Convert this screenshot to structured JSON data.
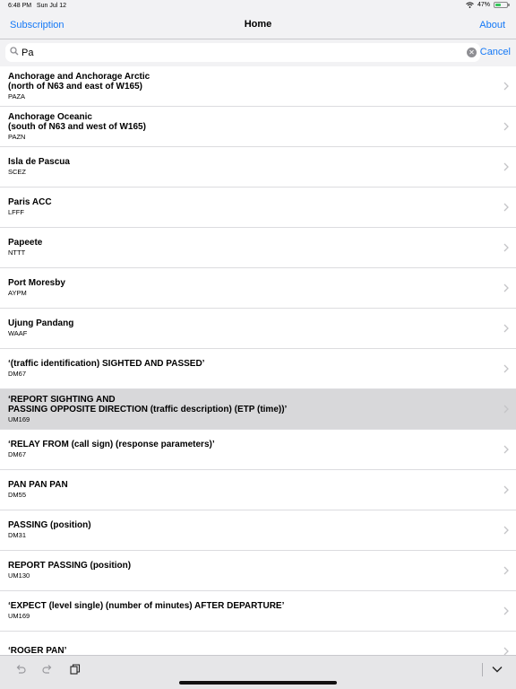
{
  "status": {
    "time": "6:48 PM",
    "date": "Sun Jul 12",
    "battery": "47%",
    "battery_level": 0.47
  },
  "nav": {
    "left": "Subscription",
    "title": "Home",
    "right": "About"
  },
  "search": {
    "value": "Pa",
    "cancel": "Cancel"
  },
  "rows": [
    {
      "title": "Anchorage and Anchorage Arctic\n(north of N63 and east of W165)",
      "code": "PAZA"
    },
    {
      "title": "Anchorage Oceanic\n(south of N63 and west of W165)",
      "code": "PAZN"
    },
    {
      "title": "Isla de Pascua",
      "code": "SCEZ"
    },
    {
      "title": "Paris ACC",
      "code": "LFFF"
    },
    {
      "title": "Papeete",
      "code": "NTTT"
    },
    {
      "title": "Port Moresby",
      "code": "AYPM"
    },
    {
      "title": "Ujung Pandang",
      "code": "WAAF"
    },
    {
      "title": "‘(traffic identification) SIGHTED AND PASSED’",
      "code": "DM67"
    },
    {
      "title": "‘REPORT SIGHTING AND\nPASSING OPPOSITE DIRECTION (traffic description) (ETP (time))’",
      "code": "UM169"
    },
    {
      "title": " ‘RELAY FROM (call sign) (response parameters)’",
      "code": "DM67"
    },
    {
      "title": "PAN PAN PAN",
      "code": "DM55"
    },
    {
      "title": "PASSING (position)",
      "code": "DM31"
    },
    {
      "title": "REPORT PASSING (position)",
      "code": "UM130"
    },
    {
      "title": "‘EXPECT (level single) (number of minutes) AFTER DEPARTURE’",
      "code": "UM169"
    },
    {
      "title": "‘ROGER PAN’",
      "code": ""
    }
  ],
  "selected_row_index": 8,
  "icons": {
    "wifi": "wifi-icon",
    "battery": "battery-icon",
    "search": "search-icon",
    "clear": "clear-icon",
    "chevron": "chevron-right-icon",
    "undo": "undo-icon",
    "redo": "redo-icon",
    "copy": "copy-icon",
    "collapse": "chevron-down-icon"
  },
  "colors": {
    "accent": "#1478f6",
    "selected_row": "#d8d8da",
    "bar": "#f2f2f4"
  }
}
